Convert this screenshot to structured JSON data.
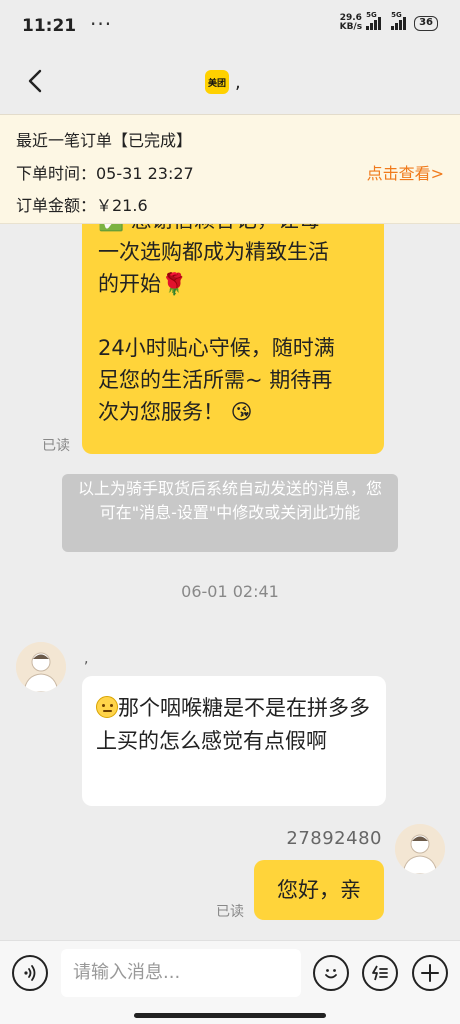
{
  "status_bar": {
    "time": "11:21",
    "dots": "···",
    "net_speed_value": "29.6",
    "net_speed_unit": "KB/s",
    "sim1": "5G",
    "sim2": "5G",
    "battery": "36"
  },
  "header": {
    "logo_text": "美团",
    "title": ","
  },
  "order": {
    "title": "最近一笔订单【已完成】",
    "time_line": "下单时间：05-31 23:27",
    "amount_line": "订单金额：￥21.6",
    "view_link": "点击查看>"
  },
  "messages": {
    "auto_reply": {
      "line1": "✅ 感谢信赖答记，让每",
      "line2": "一次选购都成为精致生活",
      "line3": "的开始🌹",
      "line4": "24小时贴心守候，随时满",
      "line5": "足您的生活所需~ 期待再",
      "line6": "次为您服务！ 😘",
      "read": "已读"
    },
    "system_notice": "以上为骑手取货后系统自动发送的消息，您可在\"消息-设置\"中修改或关闭此功能",
    "timestamp": "06-01 02:41",
    "customer": {
      "name": ",",
      "text": "那个咽喉糖是不是在拼多多上买的怎么感觉有点假啊"
    },
    "merchant": {
      "name": "27892480",
      "text": "您好，亲",
      "read": "已读"
    }
  },
  "input_bar": {
    "placeholder": "请输入消息..."
  }
}
